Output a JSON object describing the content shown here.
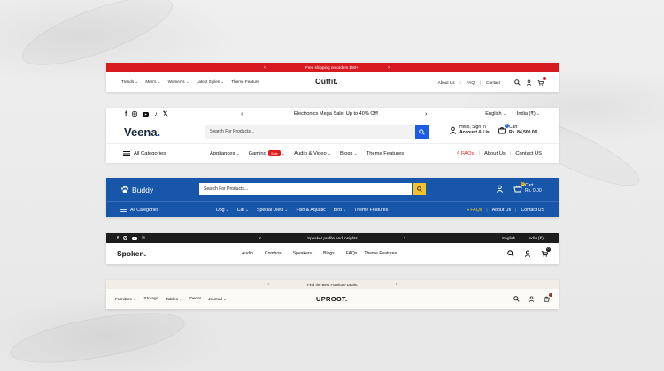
{
  "outfit": {
    "topbar_text": "Free shipping on orders $50+.",
    "logo": "Outfit.",
    "nav": [
      "Trends",
      "Men's",
      "Women's",
      "Latest Styles",
      "Theme Feature"
    ],
    "nav_chevrons": [
      true,
      true,
      true,
      true,
      false
    ],
    "links": [
      "About Us",
      "FAQ",
      "Contact"
    ],
    "accent": "#d71920"
  },
  "veena": {
    "promo_text": "Electronics Mega Sale: Up to 40% Off!",
    "language": "English",
    "currency": "India (₹)",
    "logo": "Veena",
    "logo_dot": ".",
    "search_placeholder": "Search For Products...",
    "account_line1": "Hello, Sign In",
    "account_line2": "Account & List",
    "cart_label": "Cart",
    "cart_total": "Rs. 84,500.00",
    "cart_count": "0",
    "categories_label": "All Categories",
    "nav": [
      "Appliances",
      "Gaming",
      "Audio & Video",
      "Blogs",
      "Theme Features"
    ],
    "sale_badge": "Sale",
    "links": [
      "FAQs",
      "About Us",
      "Contact US"
    ],
    "accent": "#1a5ce6"
  },
  "buddy": {
    "logo": "Buddy",
    "search_placeholder": "Search For Products...",
    "cart_label": "Cart",
    "cart_total": "Rs. 0.00",
    "cart_count": "0",
    "categories_label": "All Categories",
    "nav": [
      "Dog",
      "Cat",
      "Special Diets",
      "Fish & Aquatic",
      "Bird",
      "Theme Features"
    ],
    "nav_chevrons": [
      true,
      true,
      true,
      false,
      true,
      false
    ],
    "links": [
      "FAQs",
      "About Us",
      "Contact US"
    ],
    "accent": "#1856a9",
    "button_color": "#f3c12c"
  },
  "spoken": {
    "promo_text": "Speaker profile and insights.",
    "language": "English",
    "currency": "India (₹)",
    "logo": "Spoken.",
    "nav": [
      "Audio",
      "Combos",
      "Speakers",
      "Blogs",
      "FAQs",
      "Theme Features"
    ],
    "nav_chevrons": [
      true,
      true,
      true,
      true,
      false,
      false
    ],
    "cart_count": "0"
  },
  "uproot": {
    "promo_text": "Find the Best Furniture Deals.",
    "logo": "UPROOT.",
    "nav": [
      "Furniture",
      "Storage",
      "Tables",
      "Decor",
      "Journal"
    ],
    "nav_chevrons": [
      true,
      false,
      true,
      false,
      true
    ],
    "cart_count": "0"
  }
}
